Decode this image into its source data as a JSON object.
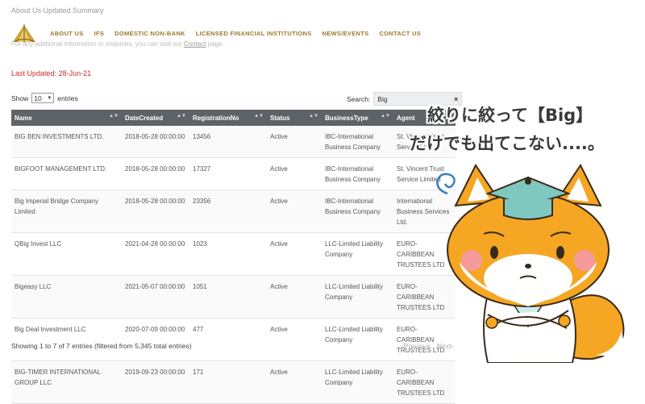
{
  "page": {
    "top_text": "About Us  Updated Summary",
    "info_text": "For any additional information or enquiries, you can visit our",
    "info_link": "Contact",
    "info_tail": "page.",
    "last_updated_label": "Last Updated:",
    "last_updated_value": "28-Jun-21"
  },
  "nav": {
    "items": [
      "ABOUT US",
      "IFS",
      "DOMESTIC NON-BANK",
      "LICENSED FINANCIAL INSTITUTIONS",
      "NEWS/EVENTS",
      "CONTACT US"
    ],
    "color": "#9a7b2c"
  },
  "controls": {
    "show_label": "Show",
    "show_value": "10",
    "entries_label": "entries",
    "search_label": "Search:",
    "search_value": "Big",
    "clear_symbol": "×"
  },
  "table": {
    "columns": [
      "Name",
      "DateCreated",
      "RegistrationNo",
      "Status",
      "BusinessType",
      "Agent"
    ],
    "rows": [
      [
        "BIG BEN INVESTMENTS LTD.",
        "2018-05-28 00:00:00",
        "13456",
        "Active",
        "IBC-International Business Company",
        "St. Vincent Trust Service Limited"
      ],
      [
        "BIGFOOT MANAGEMENT LTD.",
        "2018-05-28 00:00:00",
        "17327",
        "Active",
        "IBC-International Business Company",
        "St. Vincent Trust Service Limited"
      ],
      [
        "Big Imperial Bridge Company Limited",
        "2018-05-28 00:00:00",
        "23356",
        "Active",
        "IBC-International Business Company",
        "International Business Services Ltd."
      ],
      [
        "QBig Invest LLC",
        "2021-04-28 00:00:00",
        "1023",
        "Active",
        "LLC-Limited Liability Company",
        "EURO-CARIBBEAN TRUSTEES LTD"
      ],
      [
        "Bigeasy LLC",
        "2021-05-07 00:00:00",
        "1051",
        "Active",
        "LLC-Limited Liability Company",
        "EURO-CARIBBEAN TRUSTEES LTD"
      ],
      [
        "Big Deal Investment LLC",
        "2020-07-09 00:00:00",
        "477",
        "Active",
        "LLC-Limited Liability Company",
        "EURO-CARIBBEAN TRUSTEES LTD"
      ],
      [
        "BIG-TIMER INTERNATIONAL GROUP LLC",
        "2019-09-23 00:00:00",
        "171",
        "Active",
        "LLC-Limited Liability Company",
        "EURO-CARIBBEAN TRUSTEES LTD"
      ]
    ],
    "header_bg": "#5e6368"
  },
  "footer": {
    "summary": "Showing 1 to 7 of 7 entries (filtered from 5,345 total entries)",
    "prev": "Previous",
    "next": "Next"
  },
  "overlay": {
    "line1": "絞りに絞って【Big】",
    "line2": "だけでも出てこない....。"
  }
}
